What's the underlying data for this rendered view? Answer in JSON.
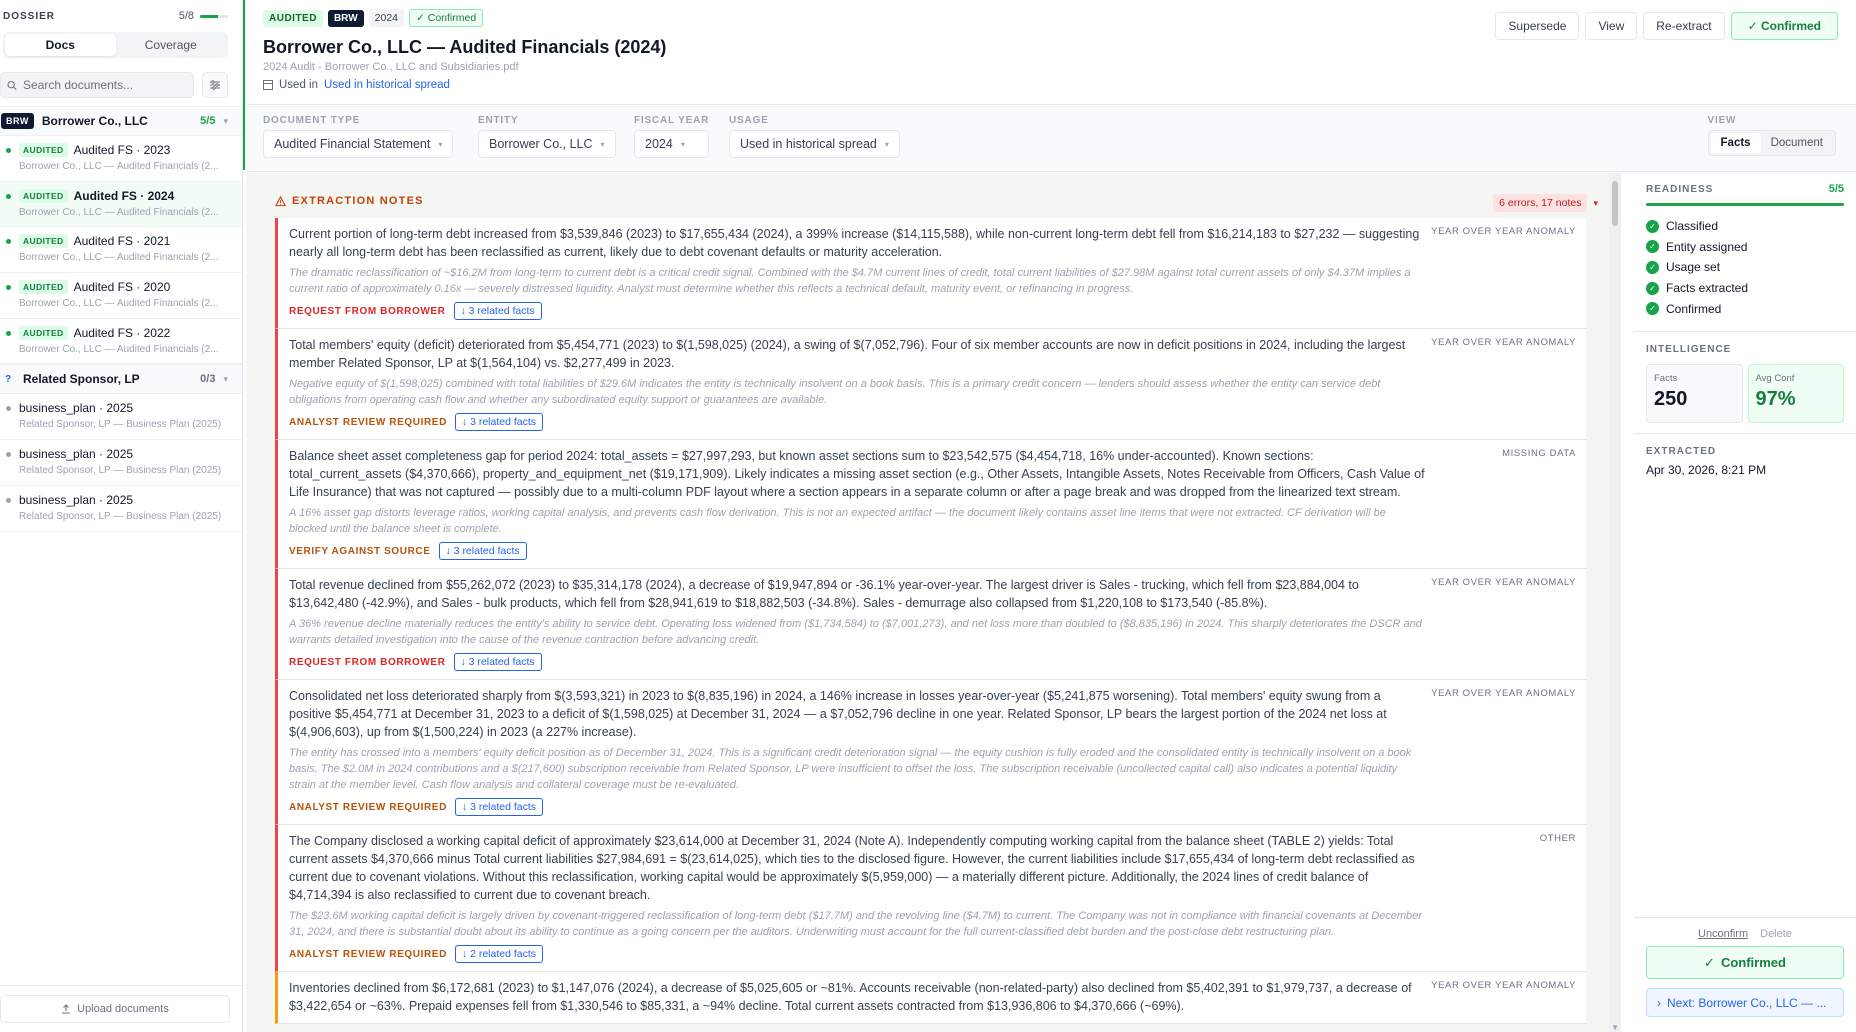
{
  "sidebar": {
    "title": "DOSSIER",
    "progress_text": "5/8",
    "progress_fraction": 0.625,
    "tabs": [
      {
        "label": "Docs"
      },
      {
        "label": "Coverage"
      }
    ],
    "search_placeholder": "Search documents...",
    "groups": [
      {
        "tag": "BRW",
        "name": "Borrower Co., LLC",
        "count": "5/5",
        "items": [
          {
            "tag": "AUDITED",
            "title": "Audited FS · 2023",
            "subtitle": "Borrower Co., LLC — Audited Financials (2..."
          },
          {
            "tag": "AUDITED",
            "title": "Audited FS · 2024",
            "subtitle": "Borrower Co., LLC — Audited Financials (2..."
          },
          {
            "tag": "AUDITED",
            "title": "Audited FS · 2021",
            "subtitle": "Borrower Co., LLC — Audited Financials (2..."
          },
          {
            "tag": "AUDITED",
            "title": "Audited FS · 2020",
            "subtitle": "Borrower Co., LLC — Audited Financials (2..."
          },
          {
            "tag": "AUDITED",
            "title": "Audited FS · 2022",
            "subtitle": "Borrower Co., LLC — Audited Financials (2..."
          }
        ]
      },
      {
        "tag": "?",
        "name": "Related Sponsor, LP",
        "count": "0/3",
        "items": [
          {
            "title": "business_plan · 2025",
            "subtitle": "Related Sponsor, LP — Business Plan (2025)"
          },
          {
            "title": "business_plan · 2025",
            "subtitle": "Related Sponsor, LP — Business Plan (2025)"
          },
          {
            "title": "business_plan · 2025",
            "subtitle": "Related Sponsor, LP — Business Plan (2025)"
          }
        ]
      }
    ],
    "upload_label": "Upload documents"
  },
  "header": {
    "badges": {
      "audited": "AUDITED",
      "brw": "BRW",
      "year": "2024",
      "confirmed": "Confirmed"
    },
    "title": "Borrower Co., LLC — Audited Financials (2024)",
    "file": "2024 Audit - Borrower Co., LLC and Subsidiaries.pdf",
    "used_in_label": "Used in",
    "used_in_link": "Used in historical spread",
    "actions": {
      "supersede": "Supersede",
      "view": "View",
      "reextract": "Re-extract",
      "confirmed": "Confirmed"
    }
  },
  "filters": {
    "document_type": {
      "label": "DOCUMENT TYPE",
      "value": "Audited Financial Statement"
    },
    "entity": {
      "label": "ENTITY",
      "value": "Borrower Co., LLC"
    },
    "fiscal_year": {
      "label": "FISCAL YEAR",
      "value": "2024"
    },
    "usage": {
      "label": "USAGE",
      "value": "Used in historical spread"
    },
    "view": {
      "label": "VIEW",
      "options": [
        "Facts",
        "Document"
      ],
      "selected": "Facts"
    }
  },
  "notes": {
    "title": "EXTRACTION NOTES",
    "summary": "6 errors, 17 notes",
    "items": [
      {
        "type": "YEAR OVER YEAR ANOMALY",
        "text": "Current portion of long-term debt increased from $3,539,846 (2023) to $17,655,434 (2024), a 399% increase ($14,115,588), while non-current long-term debt fell from $16,214,183 to $27,232 — suggesting nearly all long-term debt has been reclassified as current, likely due to debt covenant defaults or maturity acceleration.",
        "why": "The dramatic reclassification of ~$16.2M from long-term to current debt is a critical credit signal. Combined with the $4.7M current lines of credit, total current liabilities of $27.98M against total current assets of only $4.37M implies a current ratio of approximately 0.16x — severely distressed liquidity. Analyst must determine whether this reflects a technical default, maturity event, or refinancing in progress.",
        "action": "REQUEST FROM BORROWER",
        "related": "↓ 3 related facts"
      },
      {
        "type": "YEAR OVER YEAR ANOMALY",
        "text": "Total members' equity (deficit) deteriorated from $5,454,771 (2023) to $(1,598,025) (2024), a swing of $(7,052,796). Four of six member accounts are now in deficit positions in 2024, including the largest member Related Sponsor, LP at $(1,564,104) vs. $2,277,499 in 2023.",
        "why": "Negative equity of $(1,598,025) combined with total liabilities of $29.6M indicates the entity is technically insolvent on a book basis. This is a primary credit concern — lenders should assess whether the entity can service debt obligations from operating cash flow and whether any subordinated equity support or guarantees are available.",
        "action": "ANALYST REVIEW REQUIRED",
        "related": "↓ 3 related facts"
      },
      {
        "type": "MISSING DATA",
        "text": "Balance sheet asset completeness gap for period 2024: total_assets = $27,997,293, but known asset sections sum to $23,542,575 ($4,454,718, 16% under-accounted). Known sections: total_current_assets ($4,370,666), property_and_equipment_net ($19,171,909). Likely indicates a missing asset section (e.g., Other Assets, Intangible Assets, Notes Receivable from Officers, Cash Value of Life Insurance) that was not captured — possibly due to a multi-column PDF layout where a section appears in a separate column or after a page break and was dropped from the linearized text stream.",
        "why": "A 16% asset gap distorts leverage ratios, working capital analysis, and prevents cash flow derivation. This is not an expected artifact — the document likely contains asset line items that were not extracted. CF derivation will be blocked until the balance sheet is complete.",
        "action": "VERIFY AGAINST SOURCE",
        "related": "↓ 3 related facts"
      },
      {
        "type": "YEAR OVER YEAR ANOMALY",
        "text": "Total revenue declined from $55,262,072 (2023) to $35,314,178 (2024), a decrease of $19,947,894 or -36.1% year-over-year. The largest driver is Sales - trucking, which fell from $23,884,004 to $13,642,480 (-42.9%), and Sales - bulk products, which fell from $28,941,619 to $18,882,503 (-34.8%). Sales - demurrage also collapsed from $1,220,108 to $173,540 (-85.8%).",
        "why": "A 36% revenue decline materially reduces the entity's ability to service debt. Operating loss widened from ($1,734,584) to ($7,001,273), and net loss more than doubled to ($8,835,196) in 2024. This sharply deteriorates the DSCR and warrants detailed investigation into the cause of the revenue contraction before advancing credit.",
        "action": "REQUEST FROM BORROWER",
        "related": "↓ 3 related facts"
      },
      {
        "type": "YEAR OVER YEAR ANOMALY",
        "text": "Consolidated net loss deteriorated sharply from $(3,593,321) in 2023 to $(8,835,196) in 2024, a 146% increase in losses year-over-year ($5,241,875 worsening). Total members' equity swung from a positive $5,454,771 at December 31, 2023 to a deficit of $(1,598,025) at December 31, 2024 — a $7,052,796 decline in one year. Related Sponsor, LP bears the largest portion of the 2024 net loss at $(4,906,603), up from $(1,500,224) in 2023 (a 227% increase).",
        "why": "The entity has crossed into a members' equity deficit position as of December 31, 2024. This is a significant credit deterioration signal — the equity cushion is fully eroded and the consolidated entity is technically insolvent on a book basis. The $2.0M in 2024 contributions and a $(217,600) subscription receivable from Related Sponsor, LP were insufficient to offset the loss. The subscription receivable (uncollected capital call) also indicates a potential liquidity strain at the member level. Cash flow analysis and collateral coverage must be re-evaluated.",
        "action": "ANALYST REVIEW REQUIRED",
        "related": "↓ 3 related facts"
      },
      {
        "type": "OTHER",
        "text": "The Company disclosed a working capital deficit of approximately $23,614,000 at December 31, 2024 (Note A). Independently computing working capital from the balance sheet (TABLE 2) yields: Total current assets $4,370,666 minus Total current liabilities $27,984,691 = $(23,614,025), which ties to the disclosed figure. However, the current liabilities include $17,655,434 of long-term debt reclassified as current due to covenant violations. Without this reclassification, working capital would be approximately $(5,959,000) — a materially different picture. Additionally, the 2024 lines of credit balance of $4,714,394 is also reclassified to current due to covenant breach.",
        "why": "The $23.6M working capital deficit is largely driven by covenant-triggered reclassification of long-term debt ($17.7M) and the revolving line ($4.7M) to current. The Company was not in compliance with financial covenants at December 31, 2024, and there is substantial doubt about its ability to continue as a going concern per the auditors. Underwriting must account for the full current-classified debt burden and the post-close debt restructuring plan.",
        "action": "ANALYST REVIEW REQUIRED",
        "related": "↓ 2 related facts"
      },
      {
        "type": "YEAR OVER YEAR ANOMALY",
        "text": "Inventories declined from $6,172,681 (2023) to $1,147,076 (2024), a decrease of $5,025,605 or ~81%. Accounts receivable (non-related-party) also declined from $5,402,391 to $1,979,737, a decrease of $3,422,654 or ~63%. Prepaid expenses fell from $1,330,546 to $85,331, a ~94% decline. Total current assets contracted from $13,936,806 to $4,370,666 (~69%).",
        "why": "",
        "action": "",
        "related": ""
      }
    ]
  },
  "readiness": {
    "title": "READINESS",
    "count": "5/5",
    "items": [
      "Classified",
      "Entity assigned",
      "Usage set",
      "Facts extracted",
      "Confirmed"
    ]
  },
  "intelligence": {
    "title": "INTELLIGENCE",
    "facts_label": "Facts",
    "facts_value": "250",
    "conf_label": "Avg Conf",
    "conf_value": "97%"
  },
  "extracted": {
    "label": "EXTRACTED",
    "value": "Apr 30, 2026, 8:21 PM"
  },
  "footer_actions": {
    "unconfirm": "Unconfirm",
    "delete": "Delete",
    "confirmed": "Confirmed",
    "next": "Next: Borrower Co., LLC — ..."
  },
  "colors": {
    "accent_green": "#16a34a",
    "error_red": "#ef4444",
    "link_blue": "#2563eb",
    "warn_amber": "#f59e0b"
  }
}
